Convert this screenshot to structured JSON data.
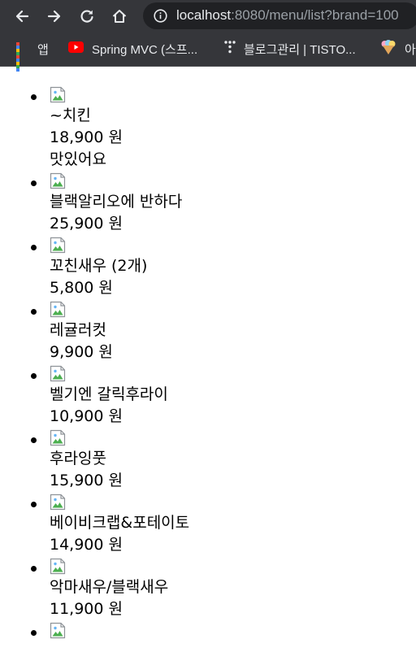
{
  "browser": {
    "url_host": "localhost",
    "url_path": ":8080/menu/list?brand=100",
    "bookmarks": [
      {
        "label": "앱",
        "icon": "apps-grid-icon"
      },
      {
        "label": "Spring MVC (스프...",
        "icon": "youtube-icon"
      },
      {
        "label": "블로그관리 | TISTO...",
        "icon": "tistory-icon"
      },
      {
        "label": "아",
        "icon": "icecream-icon"
      }
    ]
  },
  "menu": {
    "items": [
      {
        "name": "~치킨",
        "price": "18,900 원",
        "desc": "맛있어요"
      },
      {
        "name": "블랙알리오에 반하다",
        "price": "25,900 원"
      },
      {
        "name": "꼬친새우 (2개)",
        "price": "5,800 원"
      },
      {
        "name": "레귤러컷",
        "price": "9,900 원"
      },
      {
        "name": "벨기엔 갈릭후라이",
        "price": "10,900 원"
      },
      {
        "name": "후라잉풋",
        "price": "15,900 원"
      },
      {
        "name": "베이비크랩&포테이토",
        "price": "14,900 원"
      },
      {
        "name": "악마새우/블랙새우",
        "price": "11,900 원"
      },
      {
        "name": "",
        "price": ""
      }
    ]
  }
}
